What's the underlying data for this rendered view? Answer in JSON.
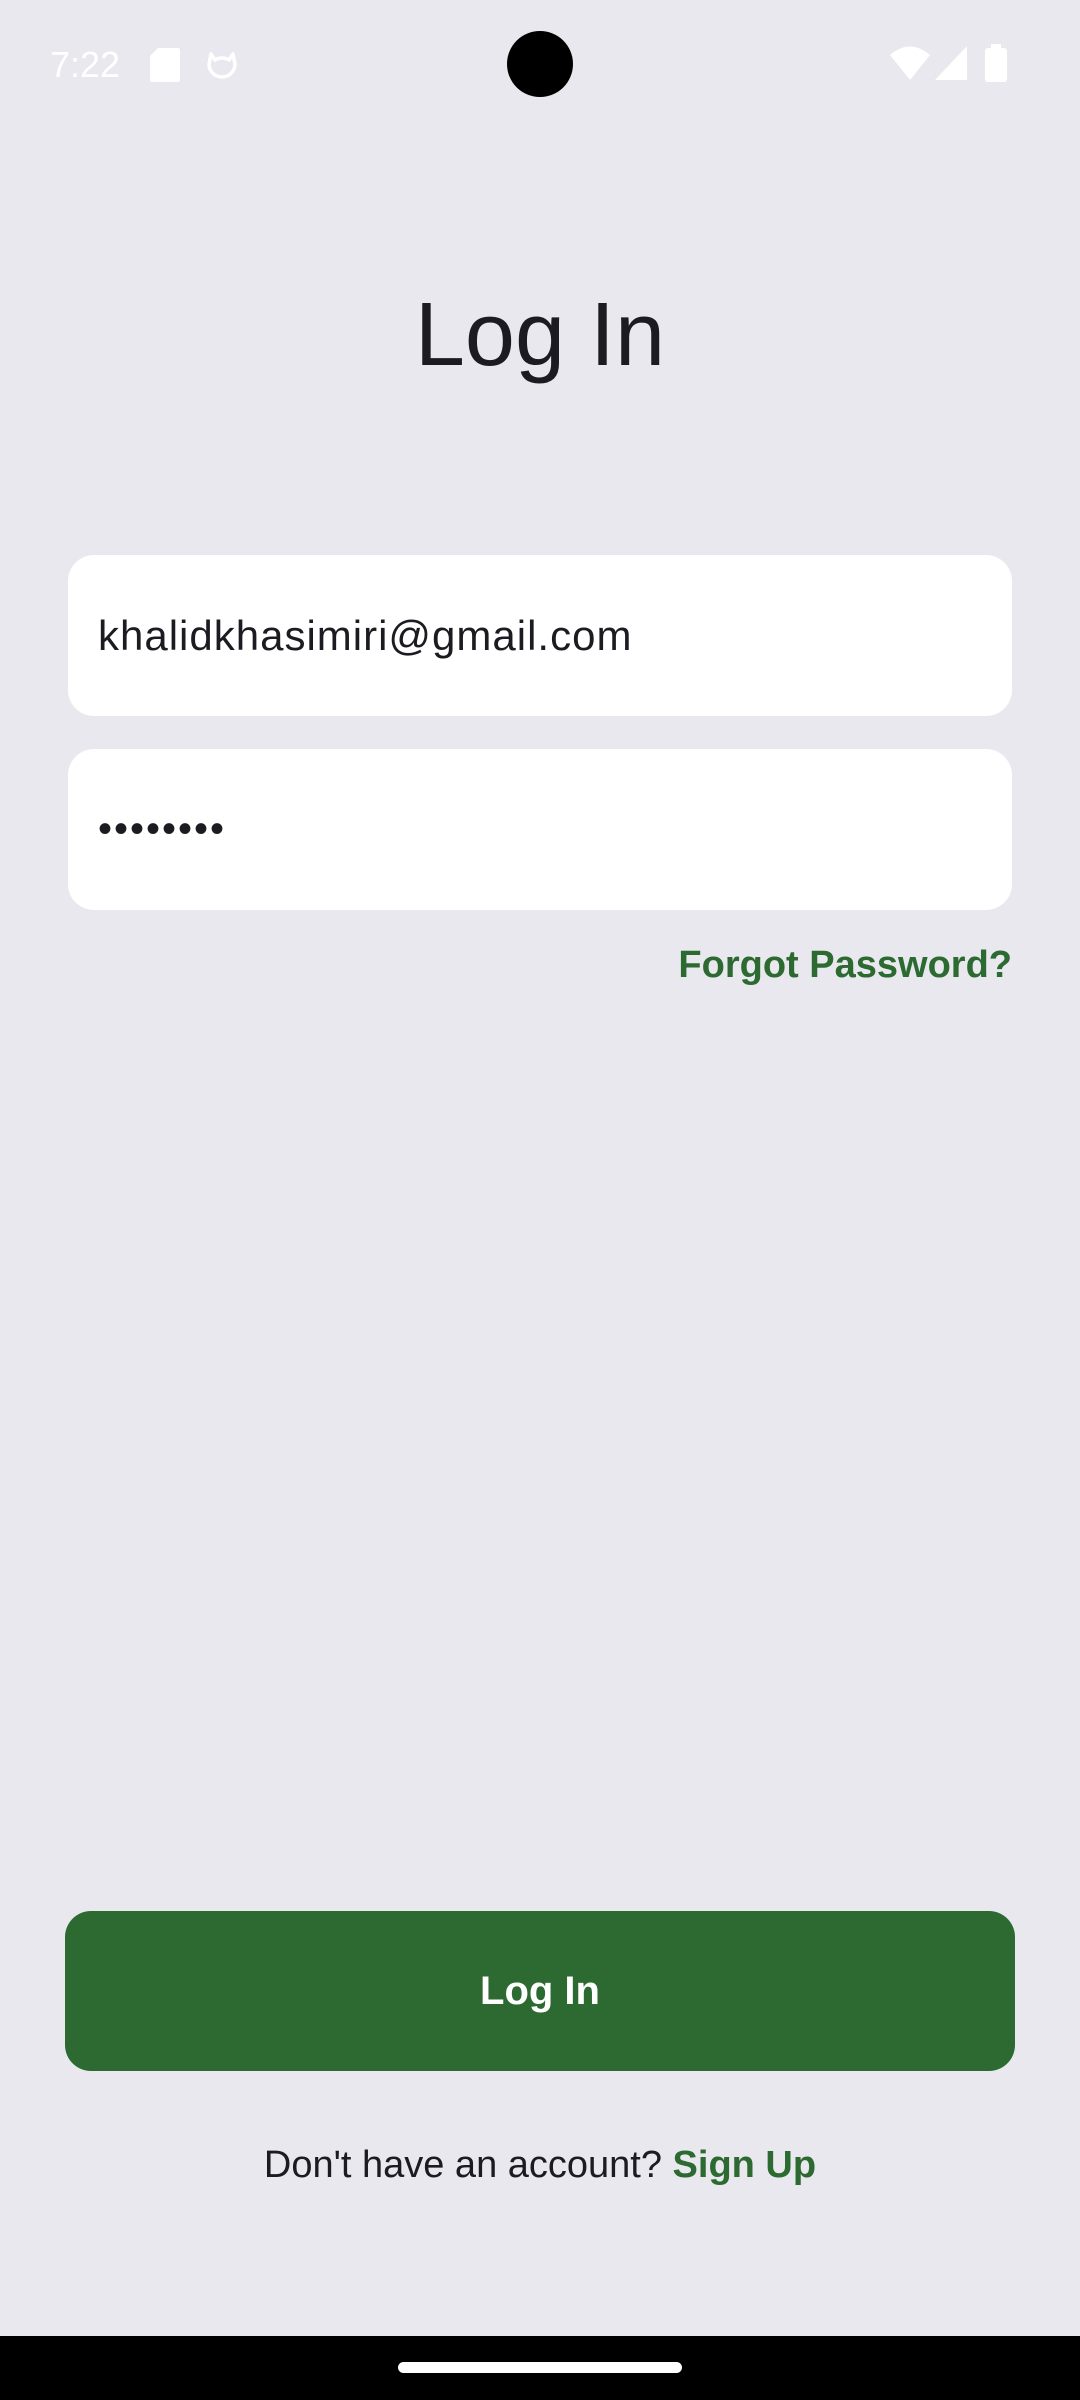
{
  "status_bar": {
    "time": "7:22",
    "icons": [
      "sd-card-icon",
      "cat-icon",
      "wifi-icon",
      "cellular-signal-icon",
      "battery-icon"
    ]
  },
  "screen": {
    "title": "Log In"
  },
  "form": {
    "email_value": "khalidkhasimiri@gmail.com",
    "password_masked": "••••••••",
    "forgot_password_label": "Forgot Password?"
  },
  "actions": {
    "login_label": "Log In",
    "signup_prompt": "Don't have an account?",
    "signup_label": "Sign Up"
  },
  "colors": {
    "background": "#e8e8ee",
    "accent": "#2d6a31",
    "field_background": "#ffffff",
    "text": "#1c1b21"
  }
}
